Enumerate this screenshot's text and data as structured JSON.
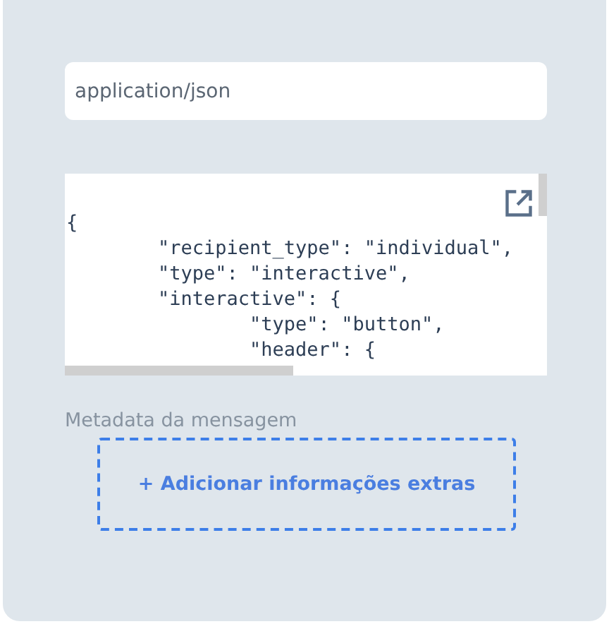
{
  "content_type_field": {
    "value": "application/json"
  },
  "body_editor": {
    "lines": [
      "{",
      "        \"recipient_type\": \"individual\",",
      "        \"type\": \"interactive\",",
      "        \"interactive\": {",
      "                \"type\": \"button\",",
      "                \"header\": {"
    ]
  },
  "metadata": {
    "label": "Metadata da mensagem",
    "add_button": "+ Adicionar informações extras"
  }
}
